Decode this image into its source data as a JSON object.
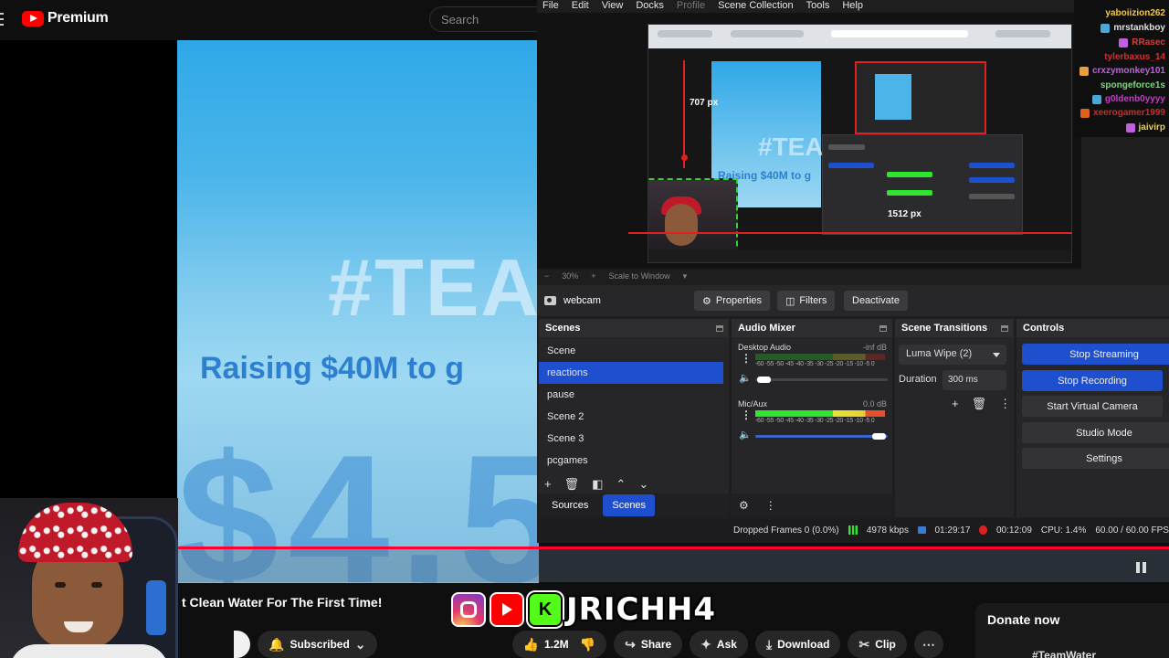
{
  "youtube": {
    "logo_text": "Premium",
    "search_placeholder": "Search",
    "video_title": "t Clean Water For The First Time!",
    "video_overlay": {
      "hashtag": "#TEA",
      "raising": "Raising $40M to g",
      "amount": "$4,5"
    },
    "subscribe_label": "Subscribed",
    "like_count": "1.2M",
    "share_label": "Share",
    "ask_label": "Ask",
    "download_label": "Download",
    "clip_label": "Clip",
    "donate_label": "Donate now",
    "donate_tag": "#TeamWater"
  },
  "socials": {
    "kick_letter": "K",
    "handle": "JRICHH4"
  },
  "obs": {
    "menu": [
      "File",
      "Edit",
      "View",
      "Docks",
      "Profile",
      "Scene Collection",
      "Tools",
      "Help"
    ],
    "preview": {
      "v_measure": "707 px",
      "h_measure": "1512 px",
      "zoom": "30%",
      "scale_mode": "Scale to Window"
    },
    "source_bar": {
      "source_name": "webcam",
      "properties_label": "Properties",
      "filters_label": "Filters",
      "deactivate_label": "Deactivate"
    },
    "scenes": {
      "title": "Scenes",
      "items": [
        "Scene",
        "reactions",
        "pause",
        "Scene 2",
        "Scene 3",
        "pcgames"
      ],
      "selected": "reactions",
      "tab_sources": "Sources",
      "tab_scenes": "Scenes"
    },
    "mixer": {
      "title": "Audio Mixer",
      "channels": [
        {
          "name": "Desktop Audio",
          "level": "-inf dB"
        },
        {
          "name": "Mic/Aux",
          "level": "0.0 dB"
        }
      ],
      "ticks": "-60 -55 -50 -45 -40 -35 -30 -25 -20 -15 -10 -5 0"
    },
    "transitions": {
      "title": "Scene Transitions",
      "selected": "Luma Wipe (2)",
      "duration_label": "Duration",
      "duration_value": "300 ms"
    },
    "controls": {
      "title": "Controls",
      "stop_streaming": "Stop Streaming",
      "stop_recording": "Stop Recording",
      "virtual_camera": "Start Virtual Camera",
      "studio_mode": "Studio Mode",
      "settings": "Settings"
    },
    "status": {
      "dropped_frames": "Dropped Frames 0 (0.0%)",
      "bitrate": "4978 kbps",
      "stream_time": "01:29:17",
      "rec_time": "00:12:09",
      "cpu": "CPU: 1.4%",
      "fps": "60.00 / 60.00 FPS"
    }
  },
  "chat": {
    "users": [
      {
        "name": "yaboiizion262",
        "color": "#f0c850"
      },
      {
        "name": "mrstankboy",
        "color": "#e0e0e0"
      },
      {
        "name": "RRasec",
        "color": "#d04040"
      },
      {
        "name": "tylerbaxus_14",
        "color": "#d03030"
      },
      {
        "name": "crxzymonkey101",
        "color": "#c060e0"
      },
      {
        "name": "spongeforce1s",
        "color": "#70e070"
      },
      {
        "name": "g0ldenb0yyyy",
        "color": "#c040c0"
      },
      {
        "name": "xeerogamer1999",
        "color": "#c03030"
      },
      {
        "name": "jaivirp",
        "color": "#e8d050"
      }
    ]
  }
}
